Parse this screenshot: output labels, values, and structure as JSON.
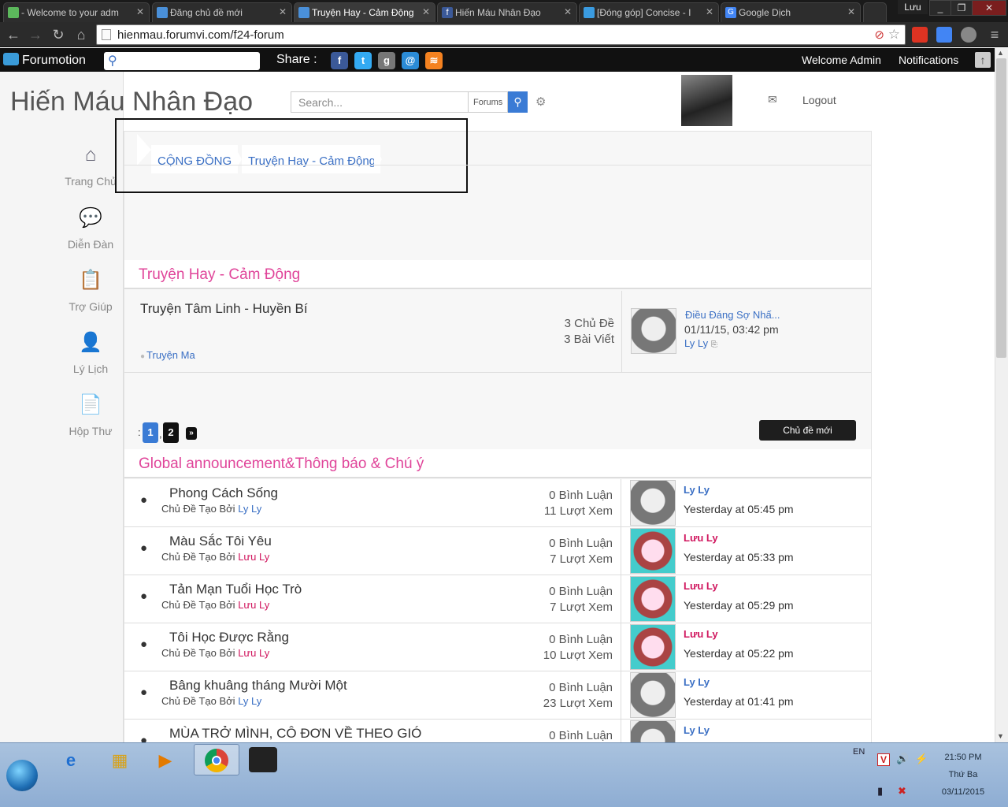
{
  "browser": {
    "tabs": [
      {
        "label": "- Welcome to your adm"
      },
      {
        "label": "Đăng chủ đề mới"
      },
      {
        "label": "Truyện Hay - Cảm Động"
      },
      {
        "label": "Hiến Máu Nhân Đạo"
      },
      {
        "label": "[Đóng góp] Concise - I"
      },
      {
        "label": "Google Dịch"
      }
    ],
    "profile_label": "Lưu",
    "url": "hienmau.forumvi.com/f24-forum"
  },
  "fmbar": {
    "brand": "Forumotion",
    "share_label": "Share :",
    "welcome": "Welcome Admin",
    "notifications": "Notifications"
  },
  "header": {
    "site_title": "Hiến Máu Nhân Đạo",
    "search_placeholder": "Search...",
    "forums_label": "Forums",
    "logout": "Logout"
  },
  "sidebar": {
    "items": [
      {
        "label": "Trang Chủ",
        "icon": "home-icon"
      },
      {
        "label": "Diễn Đàn",
        "icon": "chat-icon"
      },
      {
        "label": "Trợ Giúp",
        "icon": "clipboard-icon"
      },
      {
        "label": "Lý Lịch",
        "icon": "user-icon"
      },
      {
        "label": "Hộp Thư",
        "icon": "document-icon"
      }
    ]
  },
  "breadcrumb": [
    "CỘNG ĐỒNG",
    "Truyện Hay - Cảm Động"
  ],
  "forum_section": {
    "title": "Truyện Hay - Cảm Động",
    "forum": {
      "name": "Truyện Tâm Linh - Huyền Bí",
      "subforum": "Truyện Ma",
      "topics": "3 Chủ Đề",
      "posts": "3 Bài Viết",
      "last_post_title": "Điều Đáng Sợ Nhấ...",
      "last_post_time": "01/11/15, 03:42 pm",
      "last_post_user": "Ly Ly"
    }
  },
  "pagination": {
    "prefix": ":",
    "pages": [
      "1",
      "2"
    ],
    "sep": ",",
    "next": "»"
  },
  "new_topic_label": "Chủ đề mới",
  "announce_section": {
    "title": "Global announcement&Thông báo & Chú ý",
    "by_prefix": "Chủ Đề Tạo Bởi",
    "rows": [
      {
        "title": "Phong Cách Sống",
        "author": "Ly Ly",
        "replies": "0 Bình Luận",
        "views": "11 Lượt Xem",
        "last_user": "Ly Ly",
        "last_time": "Yesterday at 05:45 pm"
      },
      {
        "title": "Màu Sắc Tôi Yêu",
        "author": "Lưu Ly",
        "replies": "0 Bình Luận",
        "views": "7 Lượt Xem",
        "last_user": "Lưu Ly",
        "last_time": "Yesterday at 05:33 pm"
      },
      {
        "title": "Tản Mạn Tuổi Học Trò",
        "author": "Lưu Ly",
        "replies": "0 Bình Luận",
        "views": "7 Lượt Xem",
        "last_user": "Lưu Ly",
        "last_time": "Yesterday at 05:29 pm"
      },
      {
        "title": "Tôi Học Được Rằng",
        "author": "Lưu Ly",
        "replies": "0 Bình Luận",
        "views": "10 Lượt Xem",
        "last_user": "Lưu Ly",
        "last_time": "Yesterday at 05:22 pm"
      },
      {
        "title": "Bâng khuâng tháng Mười Một",
        "author": "Ly Ly",
        "replies": "0 Bình Luận",
        "views": "23 Lượt Xem",
        "last_user": "Ly Ly",
        "last_time": "Yesterday at 01:41 pm"
      },
      {
        "title": "MÙA TRỞ MÌNH, CÔ ĐƠN VỀ THEO GIÓ",
        "author": "",
        "replies": "0 Bình Luận",
        "views": "",
        "last_user": "Ly Ly",
        "last_time": ""
      }
    ]
  },
  "taskbar": {
    "lang": "EN",
    "time": "21:50 PM",
    "day": "Thứ Ba",
    "date": "03/11/2015"
  },
  "colors": {
    "accent_pink": "#e0459a",
    "link_blue": "#3a6fc4",
    "name_red": "#d0165e",
    "page_active": "#3a7bd5"
  }
}
